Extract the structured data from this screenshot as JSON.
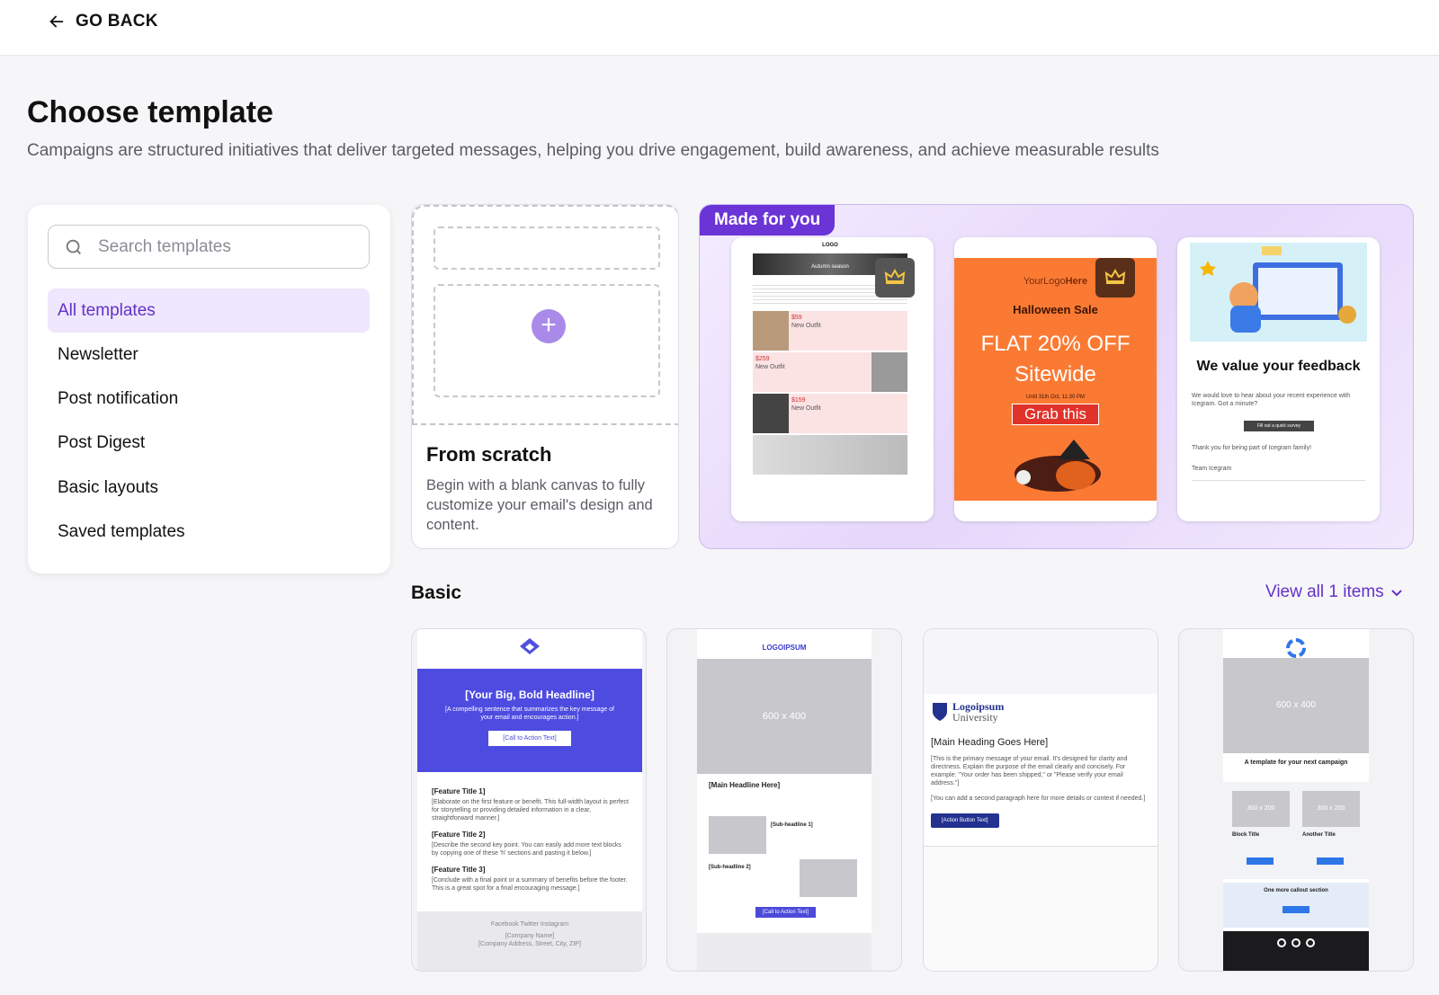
{
  "nav": {
    "back_label": "GO BACK"
  },
  "header": {
    "title": "Choose template",
    "subtitle": "Campaigns are structured initiatives that deliver targeted messages, helping you drive engagement, build awareness, and achieve measurable results"
  },
  "search": {
    "placeholder": "Search templates",
    "value": ""
  },
  "sidebar": {
    "items": [
      {
        "label": "All templates",
        "active": true
      },
      {
        "label": "Newsletter",
        "active": false
      },
      {
        "label": "Post notification",
        "active": false
      },
      {
        "label": "Post Digest",
        "active": false
      },
      {
        "label": "Basic layouts",
        "active": false
      },
      {
        "label": "Saved templates",
        "active": false
      }
    ]
  },
  "scratch": {
    "title": "From scratch",
    "description": "Begin with a blank canvas to fully customize your email's design and content."
  },
  "made_for_you": {
    "tag": "Made for you",
    "tiles": [
      {
        "logo": "LOGO",
        "banner": "Autumn season",
        "prices": [
          "$59",
          "$259",
          "$159"
        ],
        "item": "New Outfit"
      },
      {
        "logo_a": "YourLogo",
        "logo_b": "Here",
        "heading": "Halloween Sale",
        "offer_a": "FLAT 20% OFF",
        "offer_b": "Sitewide",
        "until": "Until 31th Oct, 11:30 PM",
        "cta": "Grab this"
      },
      {
        "heading": "We value your feedback",
        "body": "We would love to hear about your recent experience with Icegram. Got a minute?",
        "cta": "Fill out a quick survey",
        "thanks": "Thank you for being part of Icegram family!",
        "sign": "Team Icegram"
      }
    ]
  },
  "basic": {
    "section_title": "Basic",
    "view_all": "View all 1 items",
    "tiles": [
      {
        "headline": "[Your Big, Bold Headline]",
        "sub": "[A compelling sentence that summarizes the key message of your email and encourages action.]",
        "cta": "[Call to Action Text]",
        "features": [
          {
            "title": "[Feature Title 1]",
            "text": "[Elaborate on the first feature or benefit. This full-width layout is perfect for storytelling or providing detailed information in a clear, straightforward manner.]"
          },
          {
            "title": "[Feature Title 2]",
            "text": "[Describe the second key point. You can easily add more text blocks by copying one of these 'h' sections and pasting it below.]"
          },
          {
            "title": "[Feature Title 3]",
            "text": "[Conclude with a final point or a summary of benefits before the footer. This is a great spot for a final encouraging message.]"
          }
        ],
        "footer_links": "Facebook   Twitter   Instagram",
        "company": "[Company Name]",
        "address": "[Company Address, Street, City, ZIP]"
      },
      {
        "logo": "LOGOIPSUM",
        "image": "600 x 400",
        "headline": "[Main Headline Here]",
        "sub1": "[Sub-headline 1]",
        "sub2": "[Sub-headline 2]",
        "cta": "[Call to Action Text]"
      },
      {
        "logo_a": "Logoipsum",
        "logo_b": "University",
        "heading": "[Main Heading Goes Here]",
        "body": "[This is the primary message of your email. It's designed for clarity and directness. Explain the purpose of the email clearly and concisely. For example: \"Your order has been shipped,\" or \"Please verify your email address.\"]",
        "body2": "[You can add a second paragraph here for more details or context if needed.]",
        "cta": "[Action Button Text]"
      },
      {
        "image": "600 x 400",
        "heading": "A template for your next campaign",
        "small_img": "300 x 200",
        "block1": "Block Title",
        "block2": "Another Title",
        "callout": "One more callout section"
      }
    ]
  }
}
